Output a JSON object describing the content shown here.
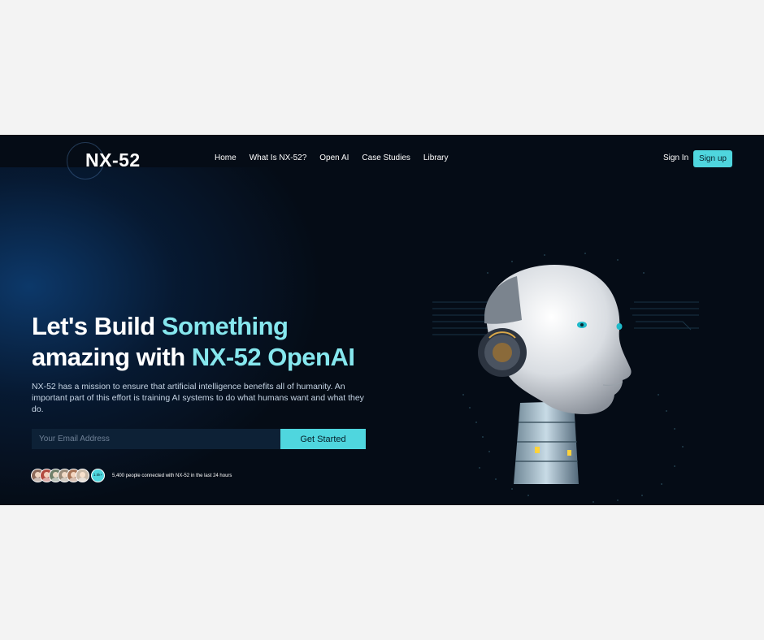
{
  "brand": {
    "logo": "NX-52"
  },
  "nav": {
    "links": [
      "Home",
      "What Is NX-52?",
      "Open AI",
      "Case Studies",
      "Library"
    ],
    "signin": "Sign In",
    "signup": "Sign up"
  },
  "hero": {
    "headline_line1_white": "Let's Build ",
    "headline_line1_accent": "Something",
    "headline_line2_white": "amazing with ",
    "headline_line2_accent": "NX-52 OpenAI",
    "description": "NX-52 has a mission to ensure that artificial intelligence benefits all of humanity. An important part of this effort is training AI systems to do what humans want and what they do.",
    "email_placeholder": "Your Email Address",
    "cta": "Get Started",
    "avatar_badge": "1.5k+",
    "social_proof": "5,400 people connected with NX-52 in the last 24 hours"
  },
  "colors": {
    "accent": "#4fd6de",
    "accent_text": "#86e7ee",
    "hero_bg": "#050c16",
    "input_bg": "#0d2136",
    "page_bg": "#f3f3f3"
  },
  "icons": [
    "user-avatar",
    "robot-head-illustration"
  ]
}
